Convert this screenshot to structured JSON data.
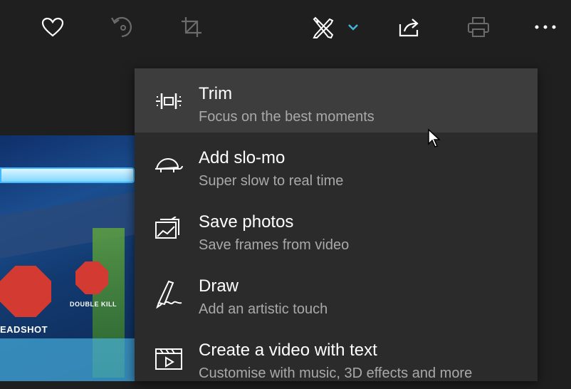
{
  "toolbar": {
    "buttons": [
      {
        "name": "favorite",
        "icon": "heart-icon"
      },
      {
        "name": "rotate",
        "icon": "rotate-icon"
      },
      {
        "name": "crop",
        "icon": "crop-icon"
      },
      {
        "name": "edit-create",
        "icon": "edit-create-icon"
      },
      {
        "name": "share",
        "icon": "share-icon"
      },
      {
        "name": "print",
        "icon": "print-icon"
      },
      {
        "name": "more",
        "icon": "more-icon"
      }
    ],
    "accent_color": "#3fb6d8"
  },
  "video": {
    "badge_left_label": "EADSHOT",
    "badge_right_label": "DOUBLE KILL"
  },
  "menu": {
    "items": [
      {
        "title": "Trim",
        "subtitle": "Focus on the best moments",
        "icon": "trim-icon",
        "selected": true
      },
      {
        "title": "Add slo-mo",
        "subtitle": "Super slow to real time",
        "icon": "turtle-icon",
        "selected": false
      },
      {
        "title": "Save photos",
        "subtitle": "Save frames from video",
        "icon": "save-photos-icon",
        "selected": false
      },
      {
        "title": "Draw",
        "subtitle": "Add an artistic touch",
        "icon": "draw-pen-icon",
        "selected": false
      },
      {
        "title": "Create a video with text",
        "subtitle": "Customise with music, 3D effects and more",
        "icon": "video-text-icon",
        "selected": false
      }
    ]
  }
}
